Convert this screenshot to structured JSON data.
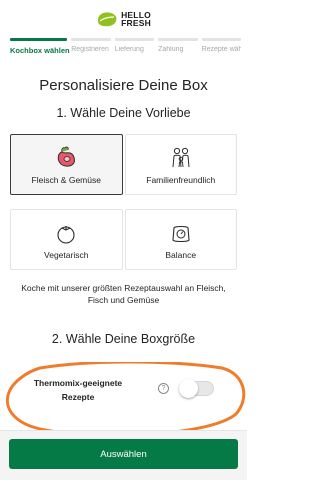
{
  "brand": {
    "line1": "HELLO",
    "line2": "FRESH",
    "accent": "#067a46",
    "logo_green": "#91c11e"
  },
  "steps": [
    {
      "label": "Kochbox wählen",
      "active": true
    },
    {
      "label": "Registrieren",
      "active": false
    },
    {
      "label": "Lieferung",
      "active": false
    },
    {
      "label": "Zahlung",
      "active": false
    },
    {
      "label": "Rezepte wählen",
      "active": false
    }
  ],
  "main": {
    "title": "Personalisiere Deine Box",
    "section1": "1. Wähle Deine Vorliebe",
    "preferences": [
      {
        "label": "Fleisch & Gemüse",
        "icon": "meat-vegetable-icon",
        "selected": true
      },
      {
        "label": "Familienfreundlich",
        "icon": "family-icon",
        "selected": false
      },
      {
        "label": "Vegetarisch",
        "icon": "tomato-icon",
        "selected": false
      },
      {
        "label": "Balance",
        "icon": "scale-icon",
        "selected": false
      }
    ],
    "description": "Koche mit unserer größten Rezeptauswahl an Fleisch, Fisch und Gemüse",
    "section2": "2. Wähle Deine Boxgröße",
    "thermomix": {
      "label": "Thermomix-geeignete Rezepte",
      "help": "?",
      "enabled": false
    }
  },
  "footer": {
    "button": "Auswählen"
  }
}
